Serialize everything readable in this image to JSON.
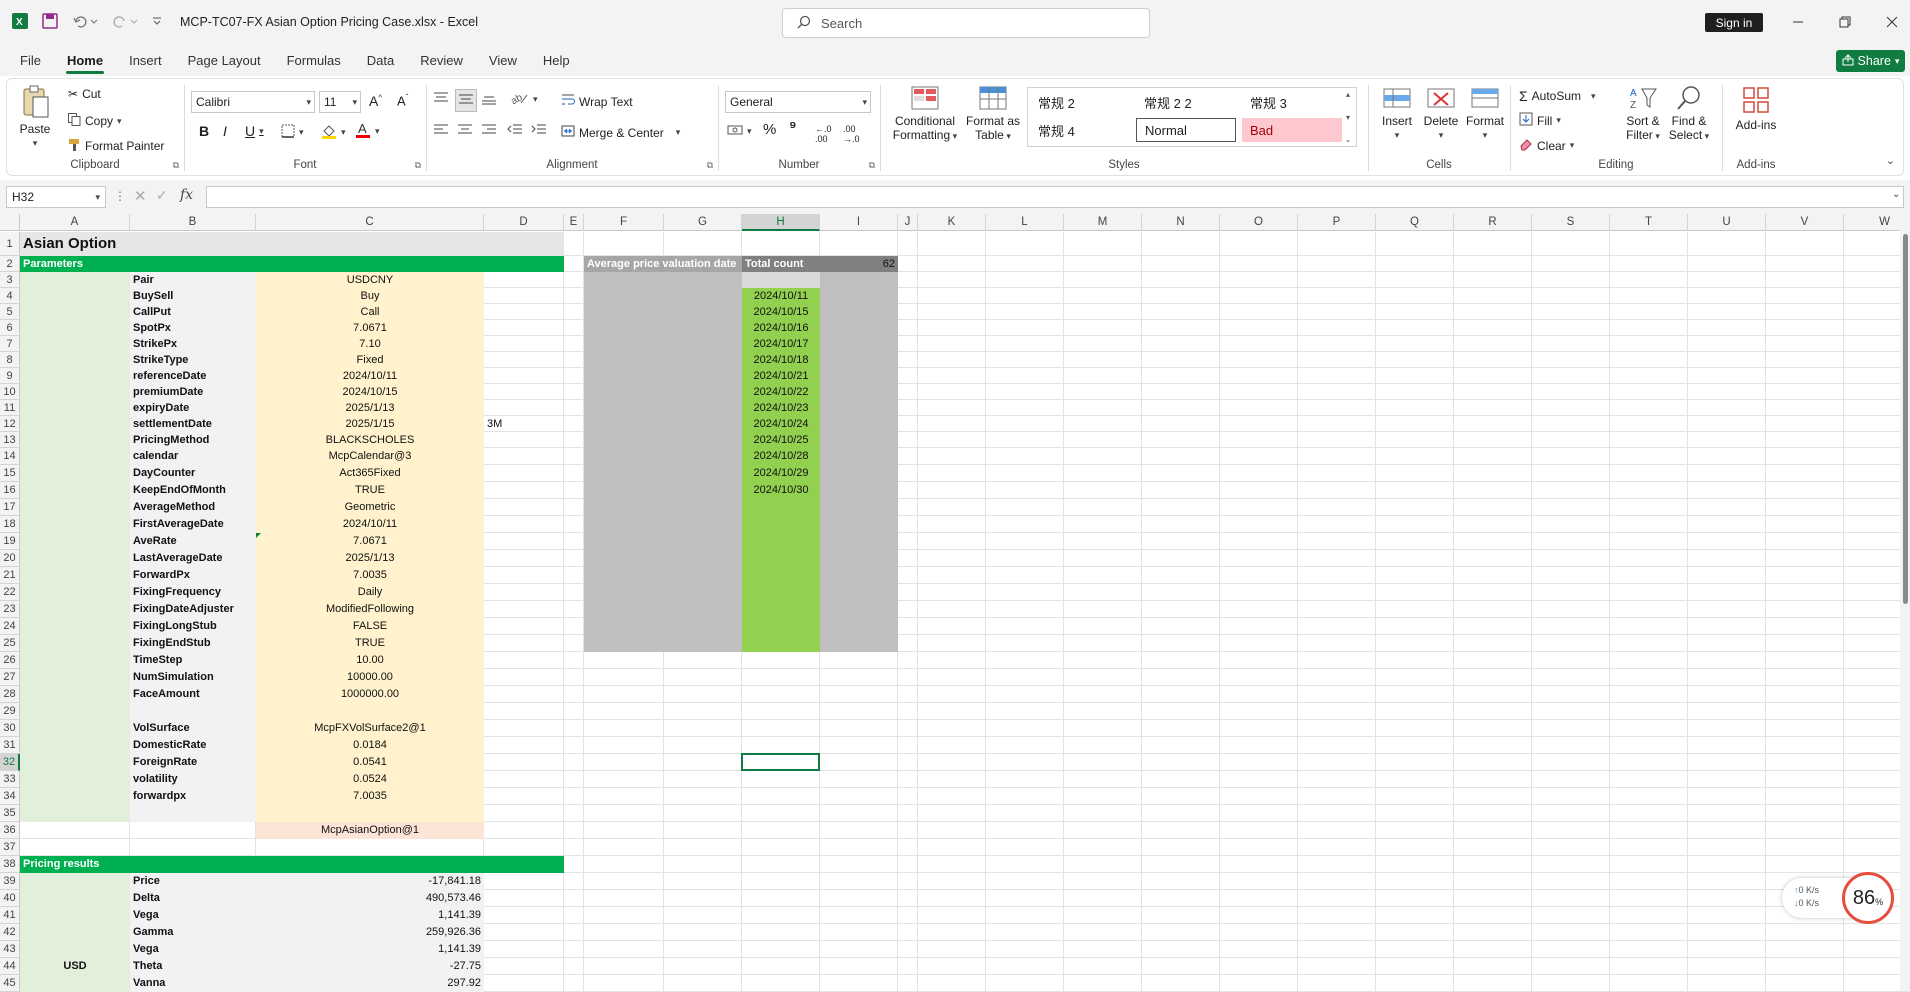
{
  "app": {
    "doc_title": "MCP-TC07-FX Asian Option Pricing Case.xlsx  -  Excel",
    "search_placeholder": "Search",
    "sign_in": "Sign in",
    "share": "Share",
    "colors": {
      "accent": "#107c41",
      "header_green": "#00b050",
      "param_fill": "#fff2cc",
      "label_fill": "#e2efda",
      "dates_fill": "#92d050",
      "grey_fill": "#bfbfbf"
    }
  },
  "menu": [
    "File",
    "Home",
    "Insert",
    "Page Layout",
    "Formulas",
    "Data",
    "Review",
    "View",
    "Help"
  ],
  "ribbon": {
    "clipboard": {
      "label": "Clipboard",
      "paste": "Paste",
      "cut": "Cut",
      "copy": "Copy",
      "format_painter": "Format Painter"
    },
    "font": {
      "label": "Font",
      "font_name": "Calibri",
      "font_size": "11"
    },
    "alignment": {
      "label": "Alignment",
      "wrap_text": "Wrap Text",
      "merge_center": "Merge & Center"
    },
    "number": {
      "label": "Number",
      "format": "General"
    },
    "styles": {
      "label": "Styles",
      "conditional_line1": "Conditional",
      "conditional_line2": "Formatting",
      "format_table_line1": "Format as",
      "format_table_line2": "Table",
      "s1": "常规 2",
      "s2": "常规 2 2",
      "s3": "常规  3",
      "s4": "常规  4",
      "normal": "Normal",
      "bad": "Bad"
    },
    "cells": {
      "label": "Cells",
      "insert": "Insert",
      "delete": "Delete",
      "format": "Format"
    },
    "editing": {
      "label": "Editing",
      "autosum": "AutoSum",
      "fill": "Fill",
      "clear": "Clear",
      "sort_line1": "Sort &",
      "sort_line2": "Filter",
      "find_line1": "Find &",
      "find_line2": "Select"
    },
    "addins": {
      "label": "Add-ins",
      "addins": "Add-ins"
    }
  },
  "formula_bar": {
    "name_box": "H32",
    "fx": "fx",
    "formula": ""
  },
  "sheet": {
    "columns": [
      "A",
      "B",
      "C",
      "D",
      "E",
      "F",
      "G",
      "H",
      "I",
      "J",
      "K",
      "L",
      "M",
      "N",
      "O",
      "P",
      "Q",
      "R",
      "S",
      "T",
      "U",
      "V",
      "W"
    ],
    "rows": [
      "1",
      "2",
      "3",
      "4",
      "5",
      "6",
      "7",
      "8",
      "9",
      "10",
      "11",
      "12",
      "13",
      "14",
      "15",
      "16",
      "17",
      "18",
      "19",
      "20",
      "21",
      "22",
      "23",
      "24",
      "25",
      "26",
      "27",
      "28",
      "29",
      "30",
      "31",
      "32",
      "33",
      "34",
      "35",
      "36",
      "37",
      "38",
      "39",
      "40",
      "41",
      "42",
      "43",
      "44",
      "45"
    ],
    "title": "Asian Option",
    "parameters_header": "Parameters",
    "params": [
      {
        "label": "Pair",
        "value": "USDCNY"
      },
      {
        "label": "BuySell",
        "value": "Buy"
      },
      {
        "label": "CallPut",
        "value": "Call"
      },
      {
        "label": "SpotPx",
        "value": "7.0671"
      },
      {
        "label": "StrikePx",
        "value": "7.10"
      },
      {
        "label": "StrikeType",
        "value": "Fixed"
      },
      {
        "label": "referenceDate",
        "value": "2024/10/11"
      },
      {
        "label": "premiumDate",
        "value": "2024/10/15"
      },
      {
        "label": "expiryDate",
        "value": "2025/1/13"
      },
      {
        "label": "settlementDate",
        "value": "2025/1/15"
      },
      {
        "label": "PricingMethod",
        "value": "BLACKSCHOLES"
      },
      {
        "label": "calendar",
        "value": "McpCalendar@3"
      },
      {
        "label": "DayCounter",
        "value": "Act365Fixed"
      },
      {
        "label": "KeepEndOfMonth",
        "value": "TRUE"
      },
      {
        "label": "AverageMethod",
        "value": "Geometric"
      },
      {
        "label": "FirstAverageDate",
        "value": "2024/10/11"
      },
      {
        "label": "AveRate",
        "value": "7.0671"
      },
      {
        "label": "LastAverageDate",
        "value": "2025/1/13"
      },
      {
        "label": "ForwardPx",
        "value": "7.0035"
      },
      {
        "label": "FixingFrequency",
        "value": "Daily"
      },
      {
        "label": "FixingDateAdjuster",
        "value": "ModifiedFollowing"
      },
      {
        "label": "FixingLongStub",
        "value": "FALSE"
      },
      {
        "label": "FixingEndStub",
        "value": "TRUE"
      },
      {
        "label": "TimeStep",
        "value": "10.00"
      },
      {
        "label": "NumSimulation",
        "value": "10000.00"
      },
      {
        "label": "FaceAmount",
        "value": "1000000.00"
      },
      {
        "label": "",
        "value": ""
      },
      {
        "label": "VolSurface",
        "value": "McpFXVolSurface2@1"
      },
      {
        "label": "DomesticRate",
        "value": "0.0184"
      },
      {
        "label": "ForeignRate",
        "value": "0.0541"
      },
      {
        "label": "volatility",
        "value": "0.0524"
      },
      {
        "label": "forwardpx",
        "value": "7.0035"
      },
      {
        "label": "",
        "value": ""
      },
      {
        "label": "",
        "value": "McpAsianOption@1"
      }
    ],
    "settlement_note": "3M",
    "avg_header": "Average price valuation date",
    "total_count_label": "Total count",
    "total_count": "62",
    "fixing_dates": [
      "2024/10/11",
      "2024/10/15",
      "2024/10/16",
      "2024/10/17",
      "2024/10/18",
      "2024/10/21",
      "2024/10/22",
      "2024/10/23",
      "2024/10/24",
      "2024/10/25",
      "2024/10/28",
      "2024/10/29",
      "2024/10/30"
    ],
    "pricing_header": "Pricing results",
    "currency": "USD",
    "results": [
      {
        "label": "Price",
        "value": "-17,841.18"
      },
      {
        "label": "Delta",
        "value": "490,573.46"
      },
      {
        "label": "Vega",
        "value": "1,141.39"
      },
      {
        "label": "Gamma",
        "value": "259,926.36"
      },
      {
        "label": "Vega",
        "value": "1,141.39"
      },
      {
        "label": "Theta",
        "value": "-27.75"
      },
      {
        "label": "Vanna",
        "value": "297.92"
      }
    ]
  },
  "status_widget": {
    "up": "0",
    "down": "0",
    "unit": "K/s",
    "percent": "86",
    "percent_sign": "%"
  }
}
